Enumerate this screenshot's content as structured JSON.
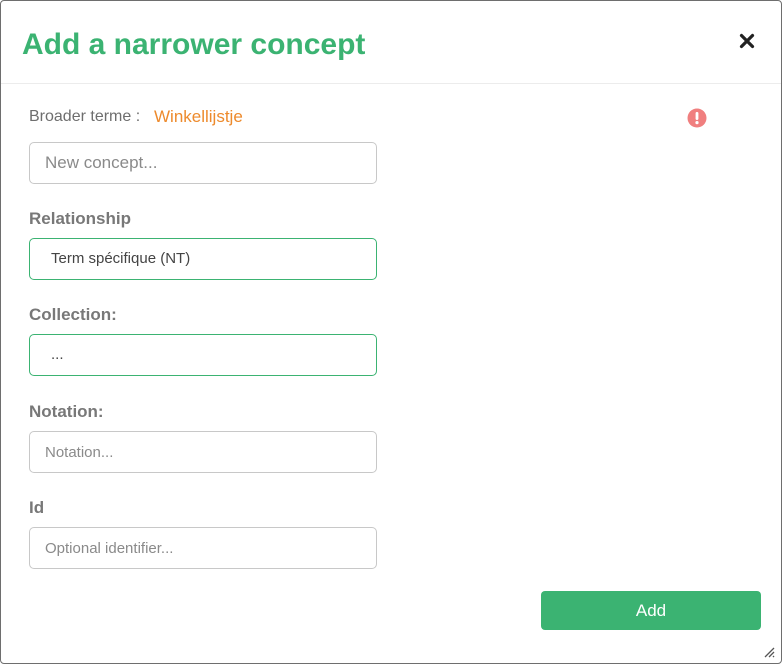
{
  "dialog": {
    "title": "Add a narrower concept",
    "close_icon": "close-icon"
  },
  "broader": {
    "label": "Broader terme :",
    "value": "Winkellijstje",
    "value_color": "#ed8a2c",
    "alert_icon": "exclamation-circle-icon",
    "alert_color": "#f07f7f"
  },
  "concept": {
    "placeholder": "New concept...",
    "value": ""
  },
  "relationship": {
    "label": "Relationship",
    "selected": "Term spécifique (NT)"
  },
  "collection": {
    "label": "Collection:",
    "selected": "..."
  },
  "notation": {
    "label": "Notation:",
    "placeholder": "Notation...",
    "value": ""
  },
  "id": {
    "label": "Id",
    "placeholder": "Optional identifier...",
    "value": ""
  },
  "actions": {
    "add_label": "Add"
  },
  "colors": {
    "accent": "#3bb372",
    "label_text": "#787878",
    "muted_text": "#6e6e6e"
  }
}
